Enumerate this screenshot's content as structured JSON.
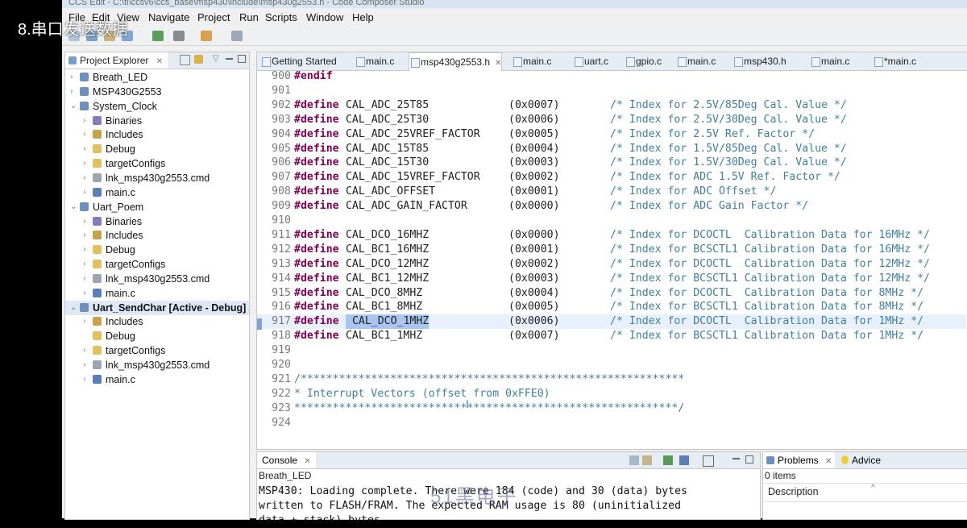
{
  "overlay_title": "8.串口发送数据",
  "window_title": "CCS Edit - C:\\ti\\ccsv6\\ccs_base\\msp430\\include\\msp430g2553.h - Code Composer Studio",
  "menu": [
    "File",
    "Edit",
    "View",
    "Navigate",
    "Project",
    "Run",
    "Scripts",
    "Window",
    "Help"
  ],
  "watermark": "51黑电子",
  "project_explorer": {
    "title": "Project Explorer",
    "close": "✕",
    "rows": [
      {
        "level": 0,
        "twisty": "›",
        "icon": "project-icon",
        "label": "Breath_LED"
      },
      {
        "level": 0,
        "twisty": "›",
        "icon": "project-icon",
        "label": "MSP430G2553"
      },
      {
        "level": 0,
        "twisty": "⌄",
        "icon": "project-icon",
        "label": "System_Clock"
      },
      {
        "level": 1,
        "twisty": "›",
        "icon": "binaries-icon",
        "label": "Binaries"
      },
      {
        "level": 1,
        "twisty": "›",
        "icon": "includes-icon",
        "label": "Includes"
      },
      {
        "level": 1,
        "twisty": "›",
        "icon": "folder-icon",
        "label": "Debug"
      },
      {
        "level": 1,
        "twisty": "›",
        "icon": "folder-icon",
        "label": "targetConfigs"
      },
      {
        "level": 1,
        "twisty": "›",
        "icon": "file-icon",
        "label": "lnk_msp430g2553.cmd"
      },
      {
        "level": 1,
        "twisty": "›",
        "icon": "c-file-icon",
        "label": "main.c"
      },
      {
        "level": 0,
        "twisty": "⌄",
        "icon": "project-icon",
        "label": "Uart_Poem"
      },
      {
        "level": 1,
        "twisty": "›",
        "icon": "binaries-icon",
        "label": "Binaries"
      },
      {
        "level": 1,
        "twisty": "›",
        "icon": "includes-icon",
        "label": "Includes"
      },
      {
        "level": 1,
        "twisty": "›",
        "icon": "folder-icon",
        "label": "Debug"
      },
      {
        "level": 1,
        "twisty": "›",
        "icon": "folder-icon",
        "label": "targetConfigs"
      },
      {
        "level": 1,
        "twisty": "›",
        "icon": "file-icon",
        "label": "lnk_msp430g2553.cmd"
      },
      {
        "level": 1,
        "twisty": "›",
        "icon": "c-file-icon",
        "label": "main.c"
      },
      {
        "level": 0,
        "twisty": "⌄",
        "icon": "project-icon",
        "label": "Uart_SendChar  [Active - Debug]"
      },
      {
        "level": 1,
        "twisty": "›",
        "icon": "includes-icon",
        "label": "Includes"
      },
      {
        "level": 1,
        "twisty": "",
        "icon": "folder-icon",
        "label": "Debug"
      },
      {
        "level": 1,
        "twisty": "›",
        "icon": "folder-icon",
        "label": "targetConfigs"
      },
      {
        "level": 1,
        "twisty": "›",
        "icon": "file-icon",
        "label": "lnk_msp430g2553.cmd"
      },
      {
        "level": 1,
        "twisty": "›",
        "icon": "c-file-icon",
        "label": "main.c"
      }
    ]
  },
  "editor": {
    "tabs": [
      "Getting Started",
      "main.c",
      "msp430g2553.h",
      "main.c",
      "uart.c",
      "gpio.c",
      "main.c",
      "msp430.h",
      "main.c",
      "*main.c"
    ],
    "active_tab": 2,
    "lines": [
      {
        "n": "900",
        "kw": "#endif",
        "rest": "",
        "val": "",
        "cm": ""
      },
      {
        "n": "901",
        "kw": "",
        "rest": "",
        "val": "",
        "cm": ""
      },
      {
        "n": "902",
        "kw": "#define",
        "rest": " CAL_ADC_25T85",
        "val": "(0x0007)",
        "cm": "/* Index for 2.5V/85Deg Cal. Value */"
      },
      {
        "n": "903",
        "kw": "#define",
        "rest": " CAL_ADC_25T30",
        "val": "(0x0006)",
        "cm": "/* Index for 2.5V/30Deg Cal. Value */"
      },
      {
        "n": "904",
        "kw": "#define",
        "rest": " CAL_ADC_25VREF_FACTOR",
        "val": "(0x0005)",
        "cm": "/* Index for 2.5V Ref. Factor */"
      },
      {
        "n": "905",
        "kw": "#define",
        "rest": " CAL_ADC_15T85",
        "val": "(0x0004)",
        "cm": "/* Index for 1.5V/85Deg Cal. Value */"
      },
      {
        "n": "906",
        "kw": "#define",
        "rest": " CAL_ADC_15T30",
        "val": "(0x0003)",
        "cm": "/* Index for 1.5V/30Deg Cal. Value */"
      },
      {
        "n": "907",
        "kw": "#define",
        "rest": " CAL_ADC_15VREF_FACTOR",
        "val": "(0x0002)",
        "cm": "/* Index for ADC 1.5V Ref. Factor */"
      },
      {
        "n": "908",
        "kw": "#define",
        "rest": " CAL_ADC_OFFSET",
        "val": "(0x0001)",
        "cm": "/* Index for ADC Offset */"
      },
      {
        "n": "909",
        "kw": "#define",
        "rest": " CAL_ADC_GAIN_FACTOR",
        "val": "(0x0000)",
        "cm": "/* Index for ADC Gain Factor */"
      },
      {
        "n": "910",
        "kw": "",
        "rest": "",
        "val": "",
        "cm": ""
      },
      {
        "n": "911",
        "kw": "#define",
        "rest": " CAL_DCO_16MHZ",
        "val": "(0x0000)",
        "cm": "/* Index for DCOCTL  Calibration Data for 16MHz */"
      },
      {
        "n": "912",
        "kw": "#define",
        "rest": " CAL_BC1_16MHZ",
        "val": "(0x0001)",
        "cm": "/* Index for BCSCTL1 Calibration Data for 16MHz */"
      },
      {
        "n": "913",
        "kw": "#define",
        "rest": " CAL_DCO_12MHZ",
        "val": "(0x0002)",
        "cm": "/* Index for DCOCTL  Calibration Data for 12MHz */"
      },
      {
        "n": "914",
        "kw": "#define",
        "rest": " CAL_BC1_12MHZ",
        "val": "(0x0003)",
        "cm": "/* Index for BCSCTL1 Calibration Data for 12MHz */"
      },
      {
        "n": "915",
        "kw": "#define",
        "rest": " CAL_DCO_8MHZ",
        "val": "(0x0004)",
        "cm": "/* Index for DCOCTL  Calibration Data for 8MHz */"
      },
      {
        "n": "916",
        "kw": "#define",
        "rest": " CAL_BC1_8MHZ",
        "val": "(0x0005)",
        "cm": "/* Index for BCSCTL1 Calibration Data for 8MHz */"
      },
      {
        "n": "917",
        "kw": "#define",
        "rest": " CAL_DCO_1MHZ",
        "val": "(0x0006)",
        "cm": "/* Index for DCOCTL  Calibration Data for 1MHz */"
      },
      {
        "n": "918",
        "kw": "#define",
        "rest": " CAL_BC1_1MHZ",
        "val": "(0x0007)",
        "cm": "/* Index for BCSCTL1 Calibration Data for 1MHz */"
      },
      {
        "n": "919",
        "kw": "",
        "rest": "",
        "val": "",
        "cm": ""
      },
      {
        "n": "920",
        "kw": "",
        "rest": "",
        "val": "",
        "cm": ""
      },
      {
        "n": "921",
        "kw": "",
        "rest": "",
        "val": "",
        "cm": "/************************************************************"
      },
      {
        "n": "922",
        "kw": "",
        "rest": "",
        "val": "",
        "cm": "* Interrupt Vectors (offset from 0xFFE0)"
      },
      {
        "n": "923",
        "kw": "",
        "rest": "",
        "val": "",
        "cm": "************************************************************/"
      },
      {
        "n": "924",
        "kw": "",
        "rest": "",
        "val": "",
        "cm": ""
      }
    ]
  },
  "console": {
    "title": "Console",
    "close": "✕",
    "project": "Breath_LED",
    "output": [
      "MSP430: Loading complete. There were 184 (code) and 30 (data) bytes",
      "written to FLASH/FRAM. The expected RAM usage is 80 (uninitialized",
      "data + stack) bytes."
    ]
  },
  "problems": {
    "title": "Problems",
    "close": "✕",
    "advice": "Advice",
    "count": "0 items",
    "column": "Description"
  },
  "colors": {
    "keyword": "#7f0055",
    "comment": "#3f7f9f",
    "selection": "#a8c6f0"
  }
}
